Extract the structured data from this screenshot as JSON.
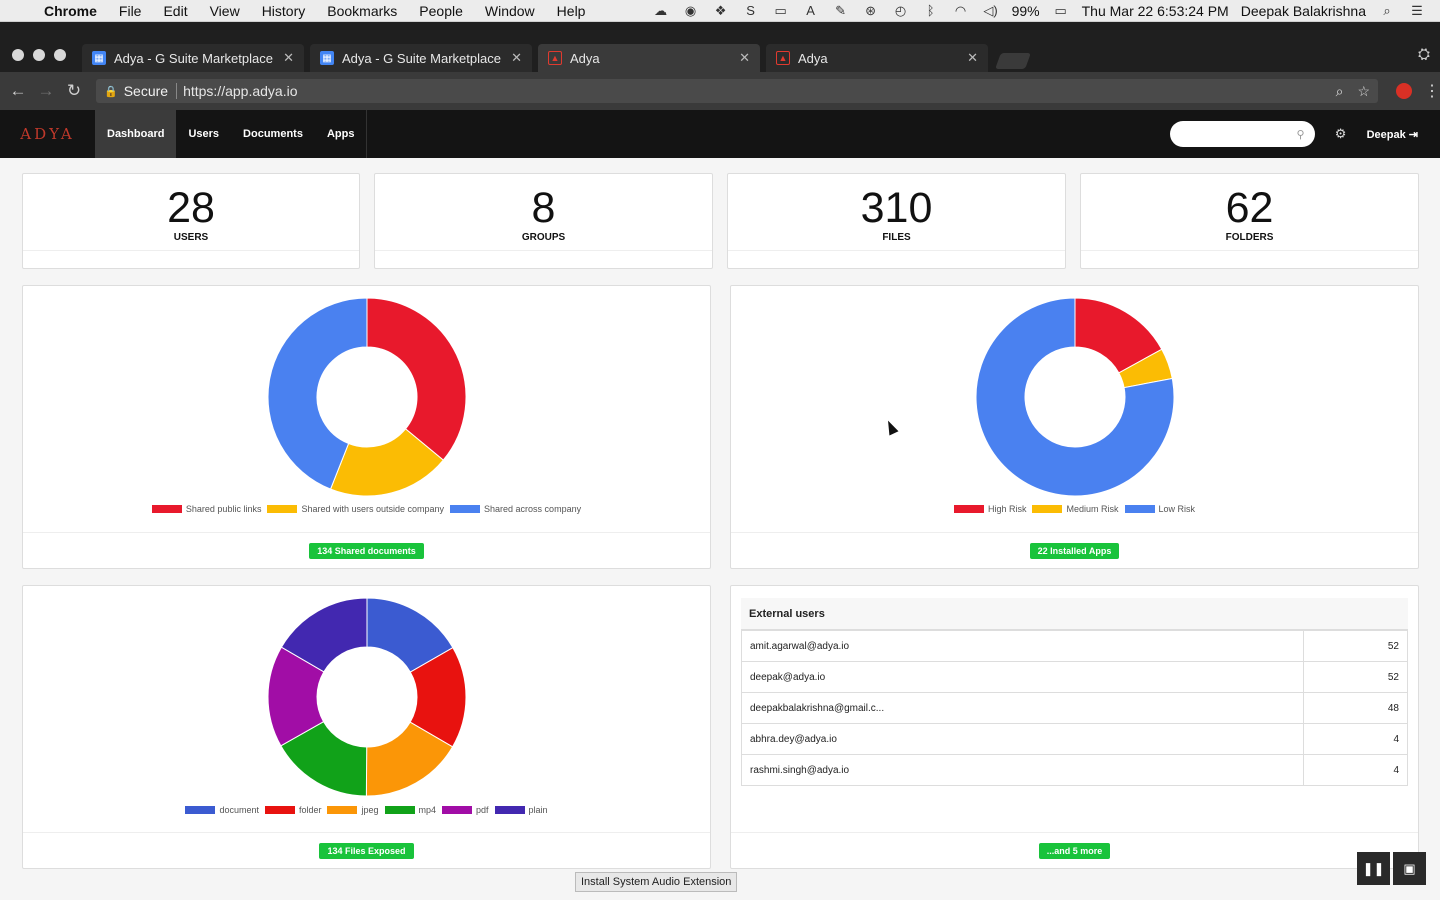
{
  "menubar": {
    "app": "Chrome",
    "items": [
      "File",
      "Edit",
      "View",
      "History",
      "Bookmarks",
      "People",
      "Window",
      "Help"
    ],
    "battery": "99%",
    "clock": "Thu Mar 22  6:53:24 PM",
    "user": "Deepak Balakrishna"
  },
  "browser": {
    "tabs": [
      {
        "title": "Adya - G Suite Marketplace",
        "favicon": "gsuite-icon"
      },
      {
        "title": "Adya - G Suite Marketplace",
        "favicon": "gsuite-icon"
      },
      {
        "title": "Adya",
        "favicon": "adya-icon"
      },
      {
        "title": "Adya",
        "favicon": "adya-icon"
      }
    ],
    "secure_label": "Secure",
    "url": "https://app.adya.io"
  },
  "appnav": {
    "brand": "ADYA",
    "links": [
      "Dashboard",
      "Users",
      "Documents",
      "Apps"
    ],
    "active": "Dashboard",
    "search_placeholder": "",
    "user": "Deepak"
  },
  "stats": [
    {
      "value": "28",
      "label": "USERS"
    },
    {
      "value": "8",
      "label": "GROUPS"
    },
    {
      "value": "310",
      "label": "FILES"
    },
    {
      "value": "62",
      "label": "FOLDERS"
    }
  ],
  "shared_docs": {
    "badge": "134 Shared documents",
    "legend": [
      "Shared public links",
      "Shared with users outside company",
      "Shared across company"
    ],
    "chart_data": {
      "type": "pie",
      "categories": [
        "Shared public links",
        "Shared with users outside company",
        "Shared across company"
      ],
      "values": [
        36,
        20,
        44
      ],
      "colors": [
        "#e8192c",
        "#fbbc04",
        "#4a81f0"
      ]
    }
  },
  "installed_apps": {
    "badge": "22 Installed Apps",
    "legend": [
      "High Risk",
      "Medium Risk",
      "Low Risk"
    ],
    "chart_data": {
      "type": "pie",
      "categories": [
        "High Risk",
        "Medium Risk",
        "Low Risk"
      ],
      "values": [
        17,
        5,
        78
      ],
      "colors": [
        "#e8192c",
        "#fbbc04",
        "#4a81f0"
      ]
    }
  },
  "files_exposed": {
    "badge": "134 Files Exposed",
    "legend": [
      "document",
      "folder",
      "jpeg",
      "mp4",
      "pdf",
      "plain"
    ],
    "chart_data": {
      "type": "pie",
      "categories": [
        "document",
        "folder",
        "jpeg",
        "mp4",
        "pdf",
        "plain"
      ],
      "values": [
        16.7,
        16.7,
        16.7,
        16.7,
        16.6,
        16.6
      ],
      "colors": [
        "#3b5bd1",
        "#e8120f",
        "#fb9607",
        "#11a219",
        "#a10da6",
        "#4228b0"
      ]
    }
  },
  "external_users": {
    "title": "External users",
    "rows": [
      {
        "email": "amit.agarwal@adya.io",
        "count": "52"
      },
      {
        "email": "deepak@adya.io",
        "count": "52"
      },
      {
        "email": "deepakbalakrishna@gmail.c...",
        "count": "48"
      },
      {
        "email": "abhra.dey@adya.io",
        "count": "4"
      },
      {
        "email": "rashmi.singh@adya.io",
        "count": "4"
      }
    ],
    "more_badge": "...and 5 more"
  },
  "tooltip": "Install System Audio Extension"
}
